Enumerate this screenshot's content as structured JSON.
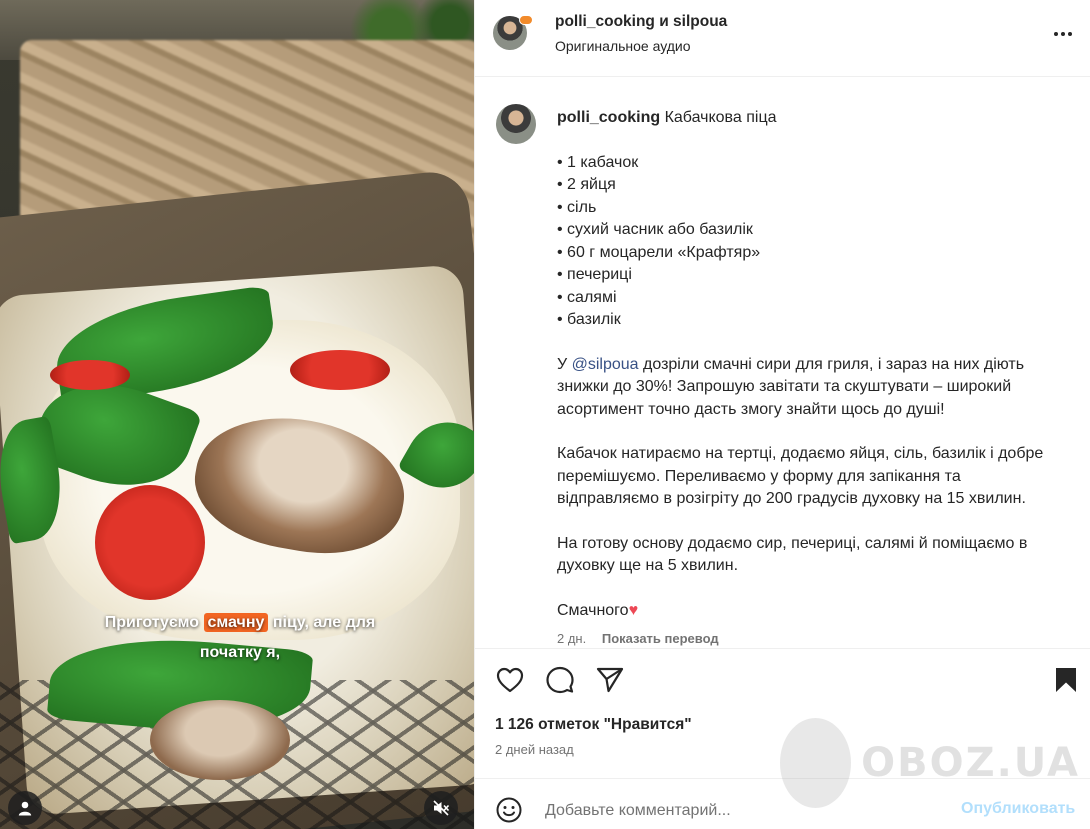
{
  "header": {
    "title": "polli_cooking и silpoua",
    "audio": "Оригинальное аудио"
  },
  "media": {
    "subtitle_pre": "Приготуємо ",
    "subtitle_highlight": "смачну",
    "subtitle_post": " піцу, але для",
    "subtitle_line2": "початку я,"
  },
  "caption": {
    "username": "polli_cooking",
    "title": "Кабачкова піца",
    "ingredients": [
      "• 1 кабачок",
      "• 2 яйця",
      "• сіль",
      "• сухий часник або базилік",
      "• 60 г моцарели «Крафтяр»",
      "• печериці",
      "• салямі",
      "• базилік"
    ],
    "para1_pre": "У ",
    "para1_mention": "@silpoua",
    "para1_post": " дозріли смачні сири для гриля, і зараз на них діють знижки до 30%! Запрошую завітати та скуштувати – широкий асортимент точно дасть змогу знайти щось до душі!",
    "para2": "Кабачок натираємо на тертці, додаємо яйця, сіль, базилік і добре перемішуємо. Переливаємо у форму для запікання та відправляємо в розігріту до 200 градусів духовку на 15 хвилин.",
    "para3": "На готову основу додаємо сир, печериці, салямі й поміщаємо в духовку ще на 5 хвилин.",
    "para4": "Смачного",
    "para4_emoji": "♥",
    "age": "2 дн.",
    "translate": "Показать перевод"
  },
  "actions": {
    "likes": "1 126 отметок \"Нравится\"",
    "time": "2 дней назад"
  },
  "comment": {
    "placeholder": "Добавьте комментарий...",
    "post_label": "Опубликовать"
  },
  "watermark": {
    "text": "OBOZ.UA"
  },
  "colors": {
    "accent_link": "#385185",
    "post_button_disabled": "#b2dffc",
    "subtitle_highlight": "#f26522"
  }
}
